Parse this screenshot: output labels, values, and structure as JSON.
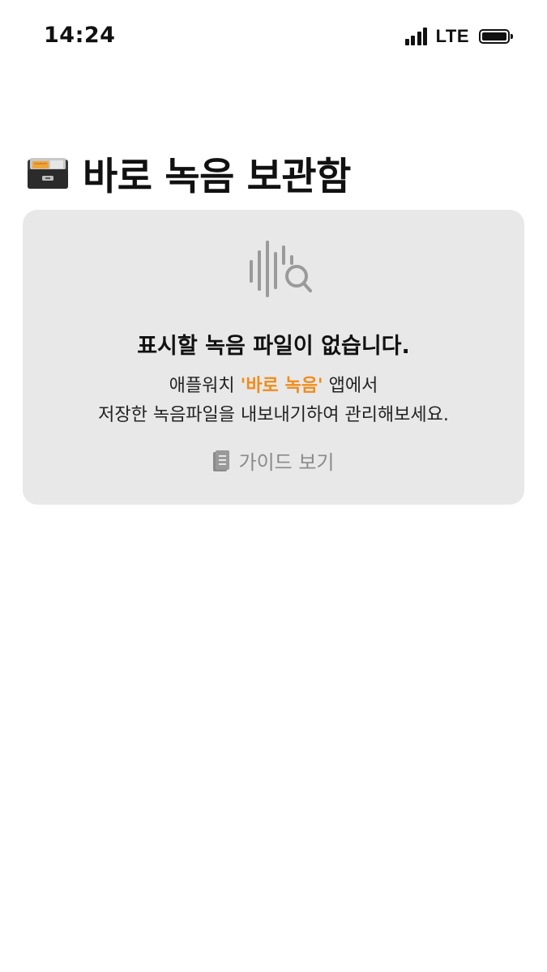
{
  "status_bar": {
    "time": "14:24",
    "network": "LTE"
  },
  "header": {
    "icon": "file-cabinet-icon",
    "title": "바로 녹음 보관함"
  },
  "empty_state": {
    "icon": "waveform-search-icon",
    "title": "표시할 녹음 파일이 없습니다.",
    "desc_line1_prefix": "애플워치 ",
    "desc_line1_highlight": "'바로 녹음'",
    "desc_line1_suffix": " 앱에서",
    "desc_line2": "저장한 녹음파일을 내보내기하여 관리해보세요.",
    "highlight_color": "#f08c1a",
    "guide_icon": "document-icon",
    "guide_label": "가이드 보기"
  }
}
